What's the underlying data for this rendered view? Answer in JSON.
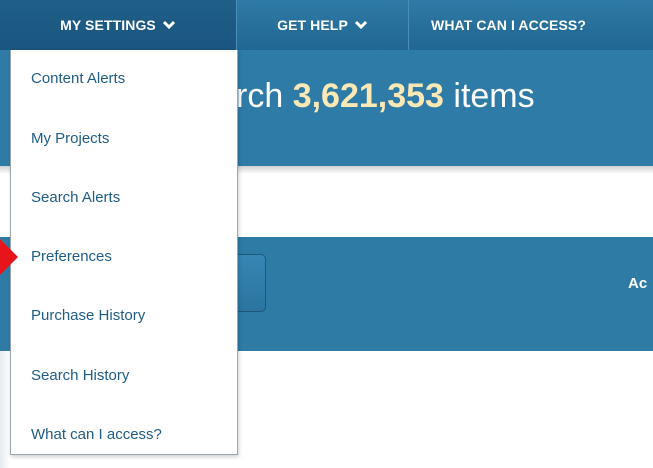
{
  "nav": {
    "items": [
      {
        "label": "MY SETTINGS",
        "has_chevron": true,
        "active": true
      },
      {
        "label": "GET HELP",
        "has_chevron": true,
        "active": false
      },
      {
        "label": "WHAT CAN I ACCESS?",
        "has_chevron": false,
        "active": false
      }
    ]
  },
  "hero": {
    "prefix": "rch ",
    "count": "3,621,353",
    "suffix": " items"
  },
  "search_band": {
    "right_text": "Ac"
  },
  "dropdown": {
    "items": [
      {
        "label": "Content Alerts"
      },
      {
        "label": "My Projects"
      },
      {
        "label": "Search Alerts"
      },
      {
        "label": "Preferences"
      },
      {
        "label": "Purchase History"
      },
      {
        "label": "Search History"
      },
      {
        "label": "What can I access?"
      }
    ]
  },
  "colors": {
    "nav_bg": "#216793",
    "hero_bg": "#2f7ba7",
    "count_color": "#fbe8b5",
    "menu_link": "#1f5d86",
    "pointer": "#e8141b"
  },
  "icons": {
    "chevron": "chevron-down-icon",
    "pointer": "red-arrow-pointer-icon"
  }
}
